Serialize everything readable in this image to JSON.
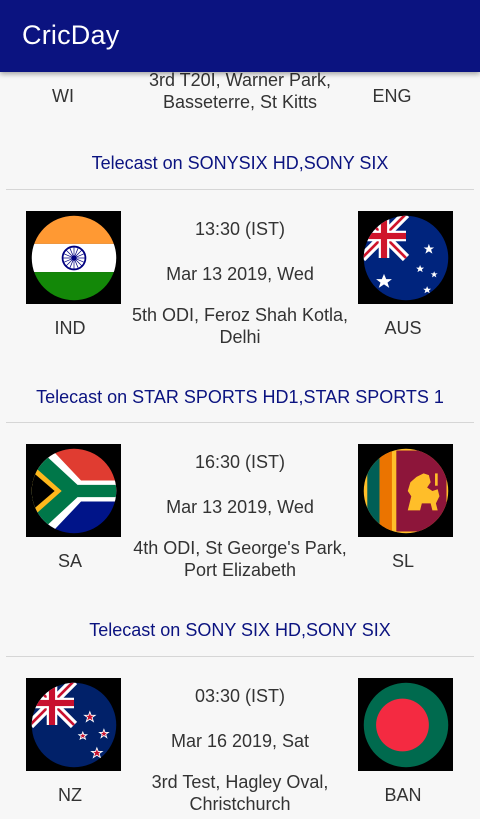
{
  "app": {
    "title": "CricDay"
  },
  "top_match": {
    "team1": "WI",
    "team2": "ENG",
    "venue": "3rd T20I, Warner Park, Basseterre, St Kitts",
    "telecast": "Telecast on SONYSIX HD,SONY SIX"
  },
  "matches": [
    {
      "team1": "IND",
      "team1_flag": "india-flag-icon",
      "team2": "AUS",
      "team2_flag": "australia-flag-icon",
      "time": "13:30 (IST)",
      "date": "Mar 13 2019, Wed",
      "venue": "5th ODI, Feroz Shah Kotla, Delhi",
      "telecast": "Telecast on STAR SPORTS HD1,STAR SPORTS 1"
    },
    {
      "team1": "SA",
      "team1_flag": "south-africa-flag-icon",
      "team2": "SL",
      "team2_flag": "sri-lanka-flag-icon",
      "time": "16:30 (IST)",
      "date": "Mar 13 2019, Wed",
      "venue": "4th ODI, St George's Park, Port Elizabeth",
      "telecast": "Telecast on SONY SIX HD,SONY SIX"
    },
    {
      "team1": "NZ",
      "team1_flag": "new-zealand-flag-icon",
      "team2": "BAN",
      "team2_flag": "bangladesh-flag-icon",
      "time": "03:30 (IST)",
      "date": "Mar 16 2019, Sat",
      "venue": "3rd Test, Hagley Oval, Christchurch"
    }
  ],
  "colors": {
    "appbar": "#0b1380",
    "telecast_text": "#0b1380"
  }
}
